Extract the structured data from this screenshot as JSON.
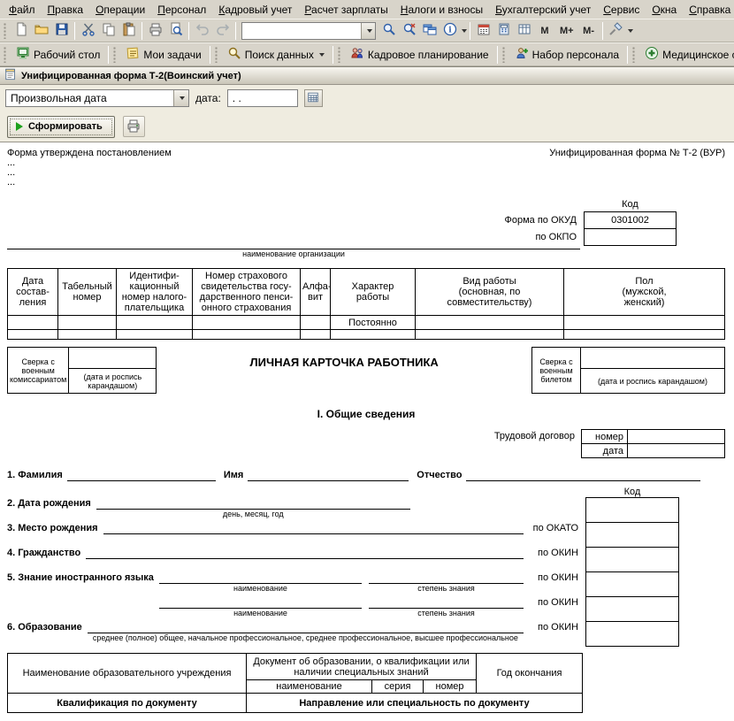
{
  "menu": {
    "items": [
      "Файл",
      "Правка",
      "Операции",
      "Персонал",
      "Кадровый учет",
      "Расчет зарплаты",
      "Налоги и взносы",
      "Бухгалтерский учет",
      "Сервис",
      "Окна",
      "Справка"
    ]
  },
  "toolbar": {
    "memory": [
      "M",
      "M+",
      "M-"
    ]
  },
  "panel": {
    "items": [
      "Рабочий стол",
      "Мои задачи",
      "Поиск данных",
      "Кадровое планирование",
      "Набор персонала",
      "Медицинское страхование"
    ]
  },
  "icons": {
    "toolbar": [
      "new-document",
      "open",
      "save",
      "cut",
      "copy",
      "paste",
      "print",
      "print-preview",
      "undo",
      "redo",
      "find",
      "cancel-find",
      "windows",
      "info",
      "calendar",
      "calculator",
      "tablo",
      "customize"
    ],
    "panel": [
      "desktop",
      "tasks",
      "search-data",
      "hr-planning",
      "recruiting",
      "med-insurance"
    ]
  },
  "form": {
    "title": "Унифицированная форма Т-2(Воинский учет)",
    "period": "Произвольная дата",
    "date_label": "дата:",
    "date_value": ". .",
    "generate": "Сформировать"
  },
  "doc": {
    "approved": "Форма утверждена постановлением",
    "form_number": "Унифицированная форма № Т-2 (ВУР)",
    "dot_line": "...",
    "code": "Код",
    "okud_label": "Форма по ОКУД",
    "okud_value": "0301002",
    "okpo_label": "по ОКПО",
    "org_caption": "наименование организации",
    "t1": {
      "h": [
        "Дата\nсостав-\nления",
        "Табельный\nномер",
        "Идентифи-\nкационный\nномер налого-\nплательщика",
        "Номер страхового\nсвидетельства госу-\nдарственного пенси-\nонного страхования",
        "Алфа-\nвит",
        "Характер\nработы",
        "Вид работы\n(основная, по\nсовместительству)",
        "Пол\n(мужской,\nженский)"
      ],
      "permanent": "Постоянно"
    },
    "card_title": "ЛИЧНАЯ КАРТОЧКА РАБОТНИКА",
    "sverka_left": "Сверка с военным комиссариатом",
    "sverka_left_note": "(дата и роспись карандашом)",
    "sverka_right": "Сверка с военным билетом",
    "sverka_right_note": "(дата и роспись карандашом)",
    "section1": "I. Общие сведения",
    "contract_label": "Трудовой договор",
    "contract_number": "номер",
    "contract_date": "дата",
    "f1": "1. Фамилия",
    "f1_name": "Имя",
    "f1_patr": "Отчество",
    "code2": "Код",
    "f2": "2. Дата рождения",
    "f2_cap": "день, месяц, год",
    "f3": "3. Место рождения",
    "f3_code": "по ОКАТО",
    "f4": "4. Гражданство",
    "f4_code": "по ОКИН",
    "f5": "5. Знание иностранного языка",
    "f5_cap1": "наименование",
    "f5_cap2": "степень знания",
    "f5_code": "по ОКИН",
    "f5b_cap1": "наименование",
    "f5b_cap2": "степень знания",
    "f5b_code": "по ОКИН",
    "f6": "6. Образование",
    "f6_cap": "среднее (полное) общее, начальное профессиональное, среднее профессиональное, высшее профессиональное",
    "f6_code": "по ОКИН",
    "edu": {
      "col_inst": "Наименование образовательного учреждения",
      "col_doc": "Документ об образовании, о квалификации или наличии специальных знаний",
      "sub1": "наименование",
      "sub2": "серия",
      "sub3": "номер",
      "col_year": "Год окончания",
      "qual": "Квалификация по документу",
      "dir": "Направление или специальность по документу"
    }
  }
}
